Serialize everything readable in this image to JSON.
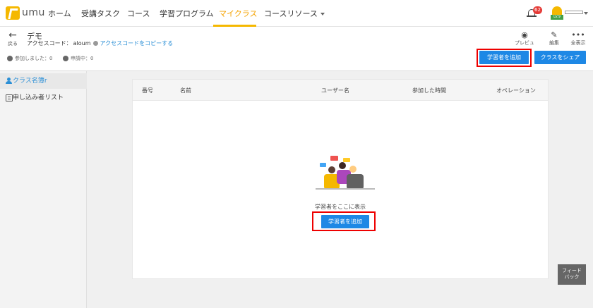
{
  "nav": {
    "logo_text": "umu",
    "items": [
      {
        "label": "ホーム"
      },
      {
        "label": "受講タスク"
      },
      {
        "label": "コース"
      },
      {
        "label": "学習プログラム"
      },
      {
        "label": "マイクラス"
      },
      {
        "label": "コースリソース"
      }
    ],
    "active_index": 4,
    "notification_count": "62",
    "avatar_level": "LV.9",
    "accent_color": "#f5b800"
  },
  "subheader": {
    "back_label": "戻る",
    "title": "デモ",
    "access_label": "アクセスコード：",
    "access_code": "aloum",
    "copy_link": "アクセスコードをコピーする",
    "joined": "参加しました：0",
    "pending": "申請中：0",
    "tools": [
      {
        "label": "プレビュー",
        "icon": "eye-icon"
      },
      {
        "label": "編集",
        "icon": "edit-icon"
      },
      {
        "label": "全表示",
        "icon": "more-icon"
      }
    ],
    "add_learner_button": "学習者を追加",
    "share_class_button": "クラスをシェア"
  },
  "sidebar": {
    "items": [
      {
        "label": "クラス名簿r",
        "icon": "person-icon"
      },
      {
        "label": "申し込み者リスト",
        "icon": "list-icon"
      }
    ]
  },
  "table": {
    "headers": [
      "番号",
      "名前",
      "ユーザー名",
      "参加した時間",
      "オペレーション"
    ],
    "empty_text": "学習者をここに表示",
    "add_button": "学習者を追加"
  },
  "feedback": {
    "line1": "フィード",
    "line2": "バック"
  },
  "colors": {
    "primary": "#1e88e5",
    "highlight": "#e00000",
    "link": "#2b8fd6"
  }
}
